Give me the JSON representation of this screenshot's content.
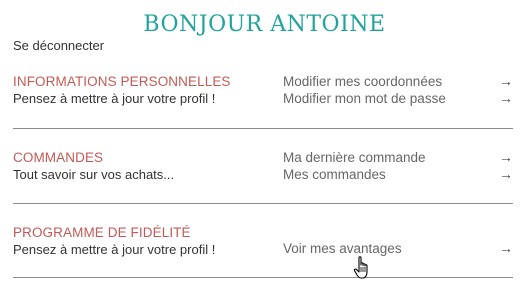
{
  "header": {
    "title": "BONJOUR ANTOINE"
  },
  "logout_label": "Se déconnecter",
  "sections": [
    {
      "title": "INFORMATIONS PERSONNELLES",
      "subtitle": "Pensez à mettre à jour votre profil !",
      "links": [
        {
          "label": "Modifier mes coordonnées",
          "icon": "arrow-right-icon"
        },
        {
          "label": "Modifier mon mot de passe",
          "icon": "arrow-right-icon"
        }
      ]
    },
    {
      "title": "COMMANDES",
      "subtitle": "Tout savoir sur vos achats...",
      "links": [
        {
          "label": "Ma dernière commande",
          "icon": "arrow-right-icon"
        },
        {
          "label": "Mes commandes",
          "icon": "arrow-right-icon"
        }
      ]
    },
    {
      "title": "PROGRAMME DE FIDÉLITÉ",
      "subtitle": "Pensez à mettre à jour votre profil !",
      "links": [
        {
          "label": "Voir mes avantages",
          "icon": "arrow-right-icon"
        }
      ]
    }
  ],
  "colors": {
    "accent": "#1fa39c",
    "section_title": "#c45a55"
  }
}
